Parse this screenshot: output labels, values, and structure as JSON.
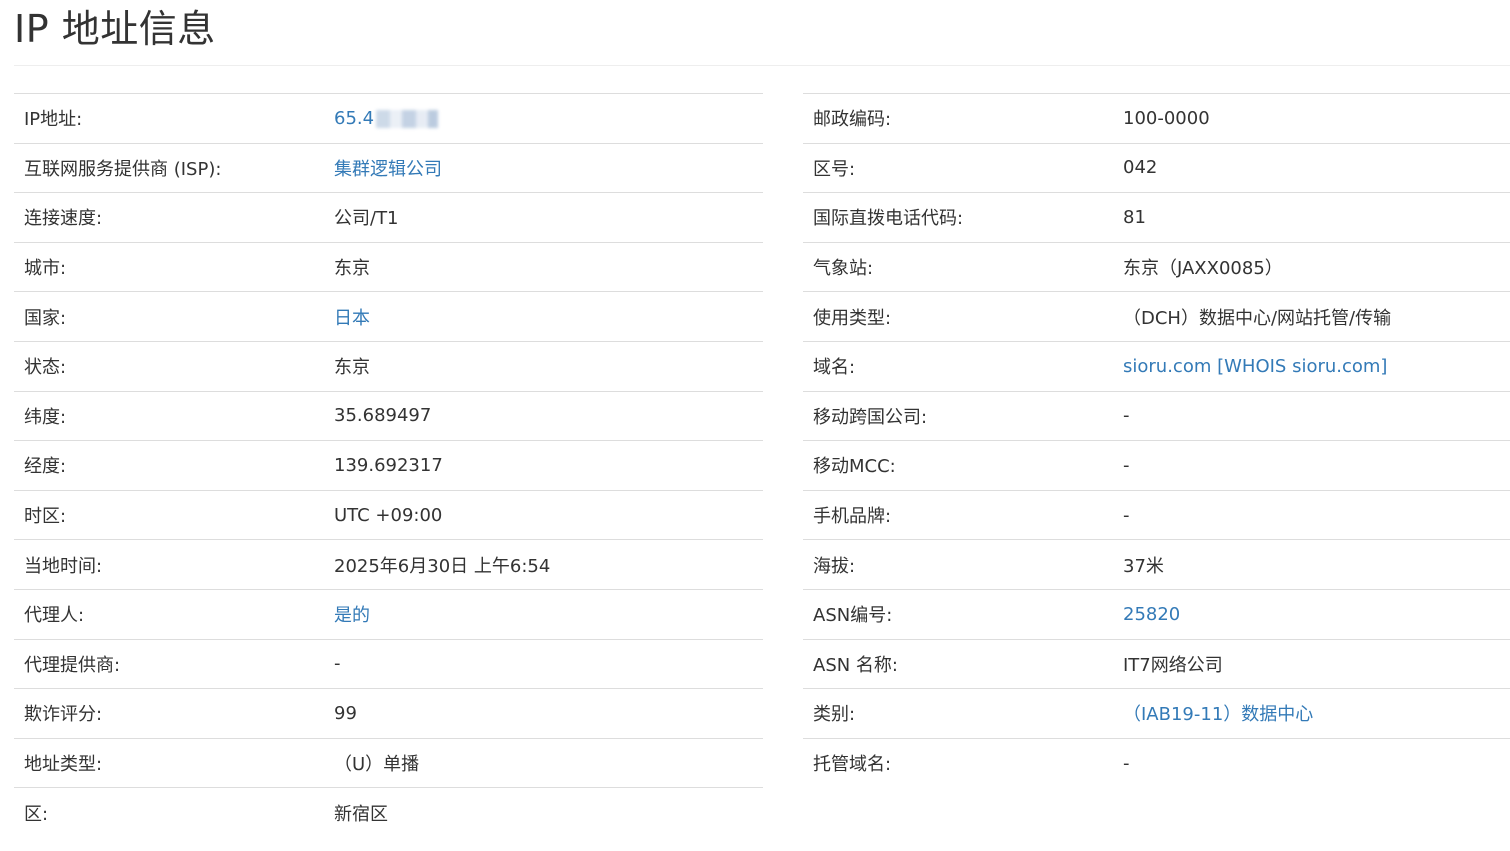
{
  "page": {
    "title": "IP 地址信息"
  },
  "left_rows": [
    {
      "label": "IP地址:",
      "value": "65.4",
      "link": true,
      "redacted": true
    },
    {
      "label": "互联网服务提供商 (ISP):",
      "value": "集群逻辑公司",
      "link": true
    },
    {
      "label": "连接速度:",
      "value": "公司/T1",
      "link": false
    },
    {
      "label": "城市:",
      "value": "东京",
      "link": false
    },
    {
      "label": "国家:",
      "value": "日本",
      "link": true
    },
    {
      "label": "状态:",
      "value": "东京",
      "link": false
    },
    {
      "label": "纬度:",
      "value": "35.689497",
      "link": false
    },
    {
      "label": "经度:",
      "value": "139.692317",
      "link": false
    },
    {
      "label": "时区:",
      "value": "UTC +09:00",
      "link": false
    },
    {
      "label": "当地时间:",
      "value": "2025年6月30日 上午6:54",
      "link": false
    },
    {
      "label": "代理人:",
      "value": "是的",
      "link": true
    },
    {
      "label": "代理提供商:",
      "value": "-",
      "link": false
    },
    {
      "label": "欺诈评分:",
      "value": "99",
      "link": false
    },
    {
      "label": "地址类型:",
      "value": "（U）单播",
      "link": false
    },
    {
      "label": "区:",
      "value": "新宿区",
      "link": false
    }
  ],
  "right_rows": [
    {
      "label": "邮政编码:",
      "value": "100-0000",
      "link": false
    },
    {
      "label": "区号:",
      "value": "042",
      "link": false
    },
    {
      "label": "国际直拨电话代码:",
      "value": "81",
      "link": false
    },
    {
      "label": "气象站:",
      "value": "东京（JAXX0085）",
      "link": false
    },
    {
      "label": "使用类型:",
      "value": "（DCH）数据中心/网站托管/传输",
      "link": false
    },
    {
      "label": "域名:",
      "value": "sioru.com [WHOIS sioru.com]",
      "link": true
    },
    {
      "label": "移动跨国公司:",
      "value": "-",
      "link": false
    },
    {
      "label": "移动MCC:",
      "value": "-",
      "link": false
    },
    {
      "label": "手机品牌:",
      "value": "-",
      "link": false
    },
    {
      "label": "海拔:",
      "value": "37米",
      "link": false
    },
    {
      "label": "ASN编号:",
      "value": "25820",
      "link": true
    },
    {
      "label": "ASN 名称:",
      "value": "IT7网络公司",
      "link": false
    },
    {
      "label": "类别:",
      "value": "（IAB19-11）数据中心",
      "link": true
    },
    {
      "label": "托管域名:",
      "value": "-",
      "link": false
    }
  ],
  "colors": {
    "link": "#337ab7",
    "text": "#333333",
    "rule": "#dddddd"
  }
}
